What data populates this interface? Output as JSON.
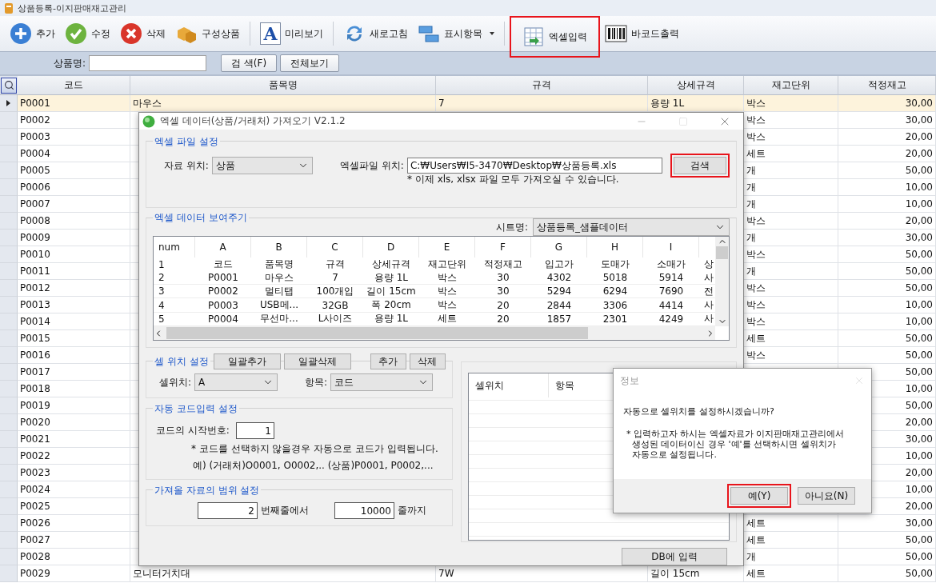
{
  "window": {
    "title": "상품등록-이지판매재고관리"
  },
  "toolbar": {
    "groups": [
      [
        {
          "kind": "add",
          "label": "추가",
          "dropdown": false,
          "highlighted": false
        },
        {
          "kind": "edit",
          "label": "수정",
          "dropdown": false,
          "highlighted": false
        },
        {
          "kind": "delete",
          "label": "삭제",
          "dropdown": false,
          "highlighted": false
        },
        {
          "kind": "bundle",
          "label": "구성상품",
          "dropdown": false,
          "highlighted": false
        }
      ],
      [
        {
          "kind": "preview",
          "label": "미리보기",
          "glyph": "A",
          "dropdown": false,
          "highlighted": false
        }
      ],
      [
        {
          "kind": "refresh",
          "label": "새로고침",
          "dropdown": false,
          "highlighted": false
        },
        {
          "kind": "columns",
          "label": "표시항목",
          "dropdown": true,
          "highlighted": false
        }
      ],
      [
        {
          "kind": "excel",
          "label": "엑셀입력",
          "dropdown": false,
          "highlighted": true
        },
        {
          "kind": "barcode",
          "label": "바코드출력",
          "dropdown": false,
          "highlighted": false
        }
      ]
    ]
  },
  "search": {
    "label": "상품명:",
    "buttons": [
      "검 색(F)",
      "전체보기"
    ]
  },
  "table": {
    "columns": [
      "코드",
      "품목명",
      "규격",
      "상세규격",
      "재고단위",
      "적정재고"
    ],
    "rows": [
      {
        "selected": true,
        "code": "P0001",
        "name": "마우스",
        "spec": "7",
        "detail": "용량 1L",
        "unit": "박스",
        "stock": "30,00"
      },
      {
        "selected": false,
        "code": "P0002",
        "unit": "박스",
        "stock": "30,00"
      },
      {
        "selected": false,
        "code": "P0003",
        "unit": "박스",
        "stock": "20,00"
      },
      {
        "selected": false,
        "code": "P0004",
        "unit": "세트",
        "stock": "20,00"
      },
      {
        "selected": false,
        "code": "P0005",
        "unit": "개",
        "stock": "50,00"
      },
      {
        "selected": false,
        "code": "P0006",
        "unit": "개",
        "stock": "10,00"
      },
      {
        "selected": false,
        "code": "P0007",
        "unit": "개",
        "stock": "10,00"
      },
      {
        "selected": false,
        "code": "P0008",
        "unit": "박스",
        "stock": "20,00"
      },
      {
        "selected": false,
        "code": "P0009",
        "unit": "개",
        "stock": "30,00"
      },
      {
        "selected": false,
        "code": "P0010",
        "unit": "박스",
        "stock": "50,00"
      },
      {
        "selected": false,
        "code": "P0011",
        "unit": "개",
        "stock": "50,00"
      },
      {
        "selected": false,
        "code": "P0012",
        "unit": "박스",
        "stock": "50,00"
      },
      {
        "selected": false,
        "code": "P0013",
        "unit": "박스",
        "stock": "10,00"
      },
      {
        "selected": false,
        "code": "P0014",
        "unit": "박스",
        "stock": "10,00"
      },
      {
        "selected": false,
        "code": "P0015",
        "unit": "세트",
        "stock": "50,00"
      },
      {
        "selected": false,
        "code": "P0016",
        "unit": "박스",
        "stock": "50,00"
      },
      {
        "selected": false,
        "code": "P0017",
        "stock": "50,00"
      },
      {
        "selected": false,
        "code": "P0018",
        "stock": "10,00"
      },
      {
        "selected": false,
        "code": "P0019",
        "stock": "50,00"
      },
      {
        "selected": false,
        "code": "P0020",
        "stock": "20,00"
      },
      {
        "selected": false,
        "code": "P0021",
        "stock": "30,00"
      },
      {
        "selected": false,
        "code": "P0022",
        "stock": "10,00"
      },
      {
        "selected": false,
        "code": "P0023",
        "stock": "20,00"
      },
      {
        "selected": false,
        "code": "P0024",
        "stock": "10,00"
      },
      {
        "selected": false,
        "code": "P0025",
        "stock": "20,00"
      },
      {
        "selected": false,
        "code": "P0026",
        "unit": "세트",
        "stock": "30,00"
      },
      {
        "selected": false,
        "code": "P0027",
        "unit": "세트",
        "stock": "50,00"
      },
      {
        "selected": false,
        "code": "P0028",
        "unit": "개",
        "stock": "50,00"
      },
      {
        "selected": false,
        "code": "P0029",
        "name": "모니터거치대",
        "spec": "7W",
        "detail": "길이 15cm",
        "unit": "세트",
        "stock": "50,00"
      }
    ]
  },
  "import_dialog": {
    "title": "엑셀 데이터(상품/거래처) 가져오기  V2.1.2",
    "file_group": {
      "legend": "엑셀 파일 설정",
      "source_label": "자료 위치:",
      "source_value": "상품",
      "path_label": "엑셀파일 위치:",
      "path_value": "C:₩Users₩I5-3470₩Desktop₩상품등록.xls",
      "browse_button": {
        "label": "검색",
        "highlighted": true
      },
      "note": "* 이제 xls, xlsx 파일 모두 가져오실 수 있습니다."
    },
    "preview_group": {
      "legend": "엑셀 데이터 보여주기",
      "sheet_label": "시트명:",
      "sheet_value": "상품등록_샘플데이터",
      "columns": [
        "num",
        "A",
        "B",
        "C",
        "D",
        "E",
        "F",
        "G",
        "H",
        "I"
      ],
      "rows": [
        [
          "1",
          "코드",
          "품목명",
          "규격",
          "상세규격",
          "재고단위",
          "적정재고",
          "입고가",
          "도매가",
          "소매가",
          "상"
        ],
        [
          "2",
          "P0001",
          "마우스",
          "7",
          "용량 1L",
          "박스",
          "30",
          "4302",
          "5018",
          "5914",
          "사"
        ],
        [
          "3",
          "P0002",
          "멀티탭",
          "100개입",
          "길이 15cm",
          "박스",
          "30",
          "5294",
          "6294",
          "7690",
          "전"
        ],
        [
          "4",
          "P0003",
          "USB메...",
          "32GB",
          "폭 20cm",
          "박스",
          "20",
          "2844",
          "3306",
          "4414",
          "사"
        ],
        [
          "5",
          "P0004",
          "무선마...",
          "L사이즈",
          "용량 1L",
          "세트",
          "20",
          "1857",
          "2301",
          "4249",
          "사"
        ]
      ]
    },
    "cell_group": {
      "legend": "셀 위치 설정",
      "buttons": [
        "일괄추가",
        "일괄삭제",
        "추가",
        "삭제"
      ],
      "cell_label": "셀위치:",
      "cell_value": "A",
      "item_label": "항목:",
      "item_value": "코드"
    },
    "code_group": {
      "legend": "자동 코드입력 설정",
      "start_label": "코드의 시작번호:",
      "start_value": "1",
      "notes": [
        "* 코드를 선택하지 않을경우 자동으로 코드가 입력됩니다.",
        "예) (거래처)O0001, O0002,..   (상품)P0001, P0002,..."
      ]
    },
    "range_group": {
      "legend": "가져올 자료의 범위 설정",
      "from_value": "2",
      "from_label": "번째줄에서",
      "to_value": "10000",
      "to_label": "줄까지"
    },
    "mapping_list": {
      "columns": [
        "셀위치",
        "항목"
      ]
    },
    "submit_button": "DB에 입력"
  },
  "message_box": {
    "title": "정보",
    "question": "자동으로 셀위치를 설정하시겠습니까?",
    "note": "* 입력하고자 하시는 엑셀자료가 이지판매재고관리에서\n  생성된 데이터이신 경우 '예'를 선택하시면 셀위치가\n  자동으로 설정됩니다.",
    "buttons": [
      {
        "label": "예(Y)",
        "highlighted": true
      },
      {
        "label": "아니요(N)",
        "highlighted": false
      }
    ]
  }
}
